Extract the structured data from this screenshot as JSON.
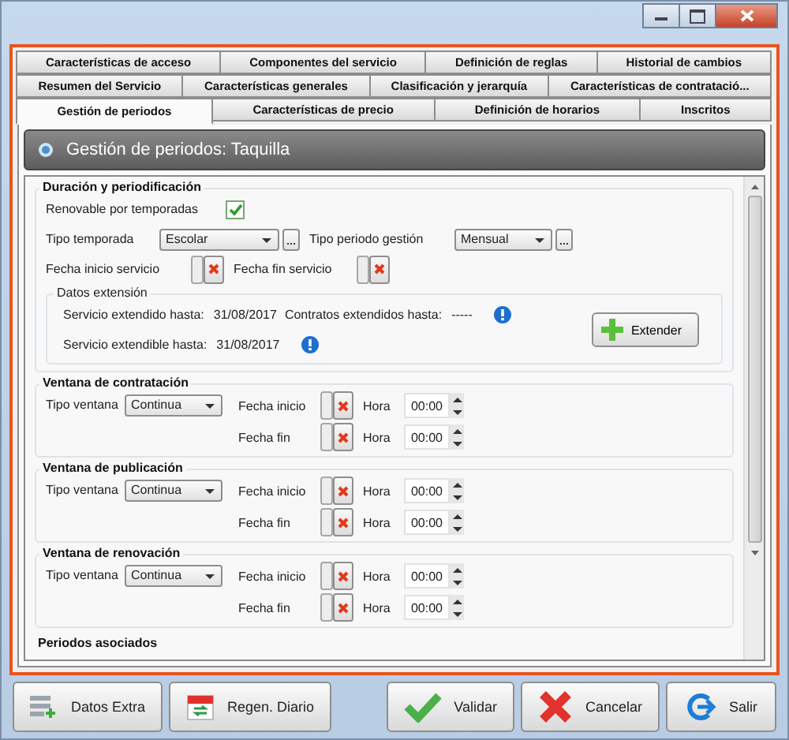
{
  "tab_rows": [
    [
      {
        "label": "Características de acceso",
        "selected": false
      },
      {
        "label": "Componentes del servicio",
        "selected": false
      },
      {
        "label": "Definición de reglas",
        "selected": false
      },
      {
        "label": "Historial de cambios",
        "selected": false
      }
    ],
    [
      {
        "label": "Resumen del Servicio",
        "selected": false
      },
      {
        "label": "Características generales",
        "selected": false
      },
      {
        "label": "Clasificación y jerarquía",
        "selected": false
      },
      {
        "label": "Características de contratació...",
        "selected": false
      }
    ],
    [
      {
        "label": "Gestión de periodos",
        "selected": true
      },
      {
        "label": "Características de precio",
        "selected": false
      },
      {
        "label": "Definición de horarios",
        "selected": false
      },
      {
        "label": "Inscritos",
        "selected": false
      }
    ]
  ],
  "panel_title": "Gestión de periodos: Taquilla",
  "duracion": {
    "title": "Duración y periodificación",
    "renovable": {
      "label": "Renovable por temporadas",
      "checked": true
    },
    "tipo_temporada": {
      "label": "Tipo temporada",
      "value": "Escolar"
    },
    "tipo_periodo": {
      "label": "Tipo periodo gestión",
      "value": "Mensual"
    },
    "fecha_inicio": {
      "label": "Fecha inicio servicio"
    },
    "fecha_fin": {
      "label": "Fecha fin servicio"
    },
    "extension": {
      "title": "Datos extensión",
      "servicio_extendido": {
        "label": "Servicio extendido hasta:",
        "value": "31/08/2017"
      },
      "contratos": {
        "label": "Contratos extendidos hasta:",
        "value": "-----"
      },
      "servicio_extendible": {
        "label": "Servicio extendible hasta:",
        "value": "31/08/2017"
      },
      "button": "Extender"
    }
  },
  "ventanas": [
    {
      "title": "Ventana de contratación",
      "tipo_label": "Tipo ventana",
      "tipo_value": "Continua",
      "rows": [
        {
          "fecha_label": "Fecha inicio",
          "hora_label": "Hora",
          "hora": "00:00"
        },
        {
          "fecha_label": "Fecha fin",
          "hora_label": "Hora",
          "hora": "00:00"
        }
      ]
    },
    {
      "title": "Ventana de publicación",
      "tipo_label": "Tipo ventana",
      "tipo_value": "Continua",
      "rows": [
        {
          "fecha_label": "Fecha inicio",
          "hora_label": "Hora",
          "hora": "00:00"
        },
        {
          "fecha_label": "Fecha fin",
          "hora_label": "Hora",
          "hora": "00:00"
        }
      ]
    },
    {
      "title": "Ventana de renovación",
      "tipo_label": "Tipo ventana",
      "tipo_value": "Continua",
      "rows": [
        {
          "fecha_label": "Fecha inicio",
          "hora_label": "Hora",
          "hora": "00:00"
        },
        {
          "fecha_label": "Fecha fin",
          "hora_label": "Hora",
          "hora": "00:00"
        }
      ]
    }
  ],
  "periodos_title": "Periodos asociados",
  "left_buttons": [
    {
      "label": "Datos Extra",
      "kind": "extra"
    },
    {
      "label": "Regen. Diario",
      "kind": "calendar"
    }
  ],
  "right_buttons": [
    {
      "label": "Validar",
      "kind": "check"
    },
    {
      "label": "Cancelar",
      "kind": "cancel"
    },
    {
      "label": "Salir",
      "kind": "exit"
    }
  ]
}
